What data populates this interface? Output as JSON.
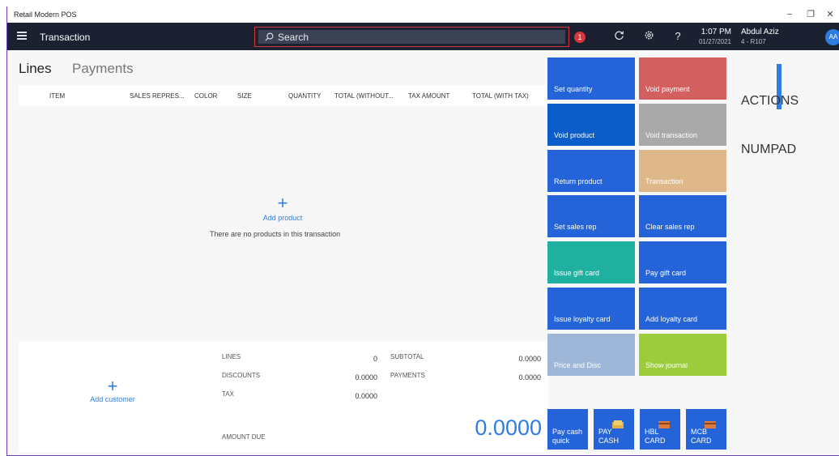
{
  "window": {
    "title": "Retail Modern POS",
    "minimize": "−",
    "restore": "❐",
    "close": "✕"
  },
  "nav": {
    "title": "Transaction",
    "search_placeholder": "Search",
    "notification_count": "1",
    "time": "1:07 PM",
    "date": "01/27/2021",
    "user_name": "Abdul Aziz",
    "store": "4 - R107",
    "avatar_initials": "AA"
  },
  "tabs": {
    "lines": "Lines",
    "payments": "Payments"
  },
  "grid": {
    "columns": [
      "ITEM",
      "SALES REPRES...",
      "COLOR",
      "SIZE",
      "QUANTITY",
      "TOTAL (WITHOUT...",
      "TAX AMOUNT",
      "TOTAL (WITH TAX)"
    ],
    "add_product": "Add product",
    "empty_message": "There are no products in this transaction"
  },
  "customer": {
    "add_label": "Add customer"
  },
  "totals": {
    "lines_label": "LINES",
    "lines_value": "0",
    "discounts_label": "DISCOUNTS",
    "discounts_value": "0.0000",
    "tax_label": "TAX",
    "tax_value": "0.0000",
    "subtotal_label": "SUBTOTAL",
    "subtotal_value": "0.0000",
    "payments_label": "PAYMENTS",
    "payments_value": "0.0000",
    "amount_due_label": "AMOUNT DUE",
    "amount_due_value": "0.0000"
  },
  "actions": [
    {
      "label": "Set quantity",
      "color": "#2564d8"
    },
    {
      "label": "Void payment",
      "color": "#d35f5f"
    },
    {
      "label": "Void product",
      "color": "#0b5ec9"
    },
    {
      "label": "Void transaction",
      "color": "#a9a9a9"
    },
    {
      "label": "Return product",
      "color": "#2564d8"
    },
    {
      "label": "Transaction",
      "color": "#dfb889"
    },
    {
      "label": "Set sales rep",
      "color": "#2564d8"
    },
    {
      "label": "Clear sales rep",
      "color": "#2564d8"
    },
    {
      "label": "Issue gift card",
      "color": "#20b0a0"
    },
    {
      "label": "Pay gift card",
      "color": "#2564d8"
    },
    {
      "label": "Issue loyalty card",
      "color": "#2564d8"
    },
    {
      "label": "Add loyalty card",
      "color": "#2564d8"
    },
    {
      "label": "Price and Disc",
      "color": "#9eb7d8"
    },
    {
      "label": "Show journal",
      "color": "#9ccb3b"
    }
  ],
  "payment_tiles": [
    {
      "label": "Pay cash quick"
    },
    {
      "label": "PAY CASH"
    },
    {
      "label": "HBL CARD"
    },
    {
      "label": "MCB CARD"
    }
  ],
  "rail": {
    "actions": "ACTIONS",
    "numpad": "NUMPAD"
  },
  "icons": {
    "search": "search-icon",
    "refresh": "refresh-icon",
    "settings": "gear-icon",
    "help": "help-icon",
    "menu": "hamburger-icon"
  }
}
